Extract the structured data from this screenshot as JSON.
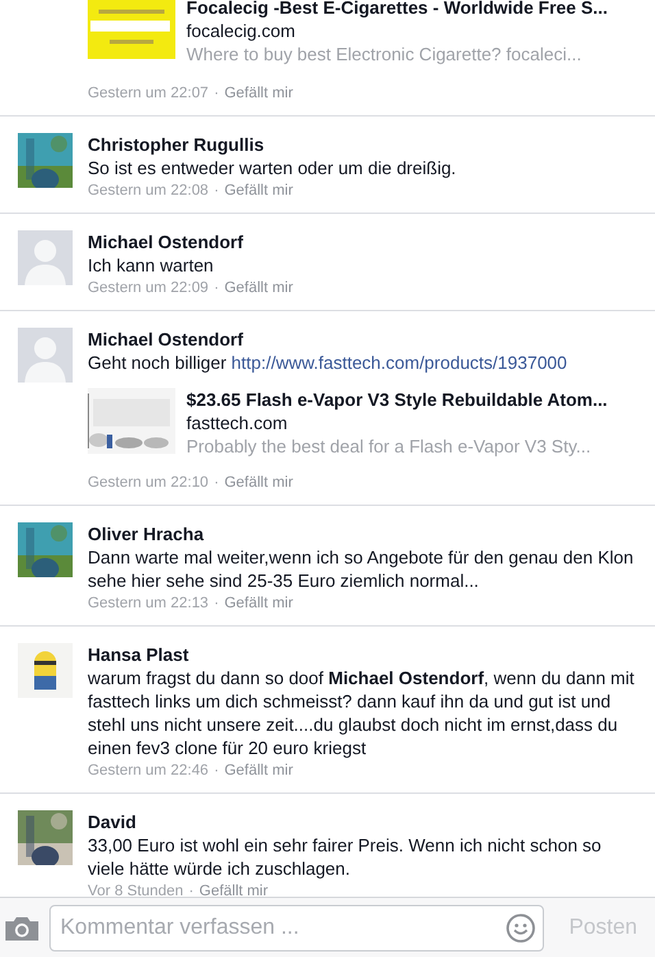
{
  "comments": [
    {
      "preview": {
        "title": "Focalecig -Best E-Cigarettes - Worldwide Free S...",
        "domain": "focalecig.com",
        "description": "Where to buy best Electronic Cigarette? focaleci..."
      },
      "time": "Gestern um 22:07",
      "dot": "·",
      "like": "Gefällt mir"
    },
    {
      "name": "Christopher Rugullis",
      "text": "So ist es entweder warten oder um die dreißig.",
      "time": "Gestern um 22:08",
      "dot": "·",
      "like": "Gefällt mir"
    },
    {
      "avatar": {
        "kind": "default"
      },
      "name": "Michael Ostendorf",
      "text": "Ich kann warten",
      "time": "Gestern um 22:09",
      "dot": "·",
      "like": "Gefällt mir"
    },
    {
      "avatar": {
        "kind": "default"
      },
      "name": "Michael Ostendorf",
      "text": "Geht noch billiger",
      "link": "http://www.fasttech.com/products/1937000",
      "preview": {
        "title": "$23.65 Flash e-Vapor V3 Style Rebuildable Atom...",
        "domain": "fasttech.com",
        "description": "Probably the best deal for a Flash e-Vapor V3 Sty..."
      },
      "time": "Gestern um 22:10",
      "dot": "·",
      "like": "Gefällt mir"
    },
    {
      "name": "Oliver Hracha",
      "text": "Dann warte mal weiter,wenn ich so Angebote für den genau den Klon sehe hier sehe sind 25-35 Euro ziemlich normal...",
      "time": "Gestern um 22:13",
      "dot": "·",
      "like": "Gefällt mir"
    },
    {
      "avatar": {
        "kind": "figure"
      },
      "name": "Hansa Plast",
      "text": "warum fragst du dann so doof **Michael Ostendorf**, wenn du dann mit fasttech links um dich schmeisst? dann kauf ihn da und gut ist und stehl uns nicht unsere zeit....du glaubst doch nicht im ernst,dass du einen fev3 clone für 20 euro kriegst",
      "time": "Gestern um 22:46",
      "dot": "·",
      "like": "Gefällt mir"
    },
    {
      "name": "David",
      "text": "33,00 Euro ist wohl ein sehr fairer Preis. Wenn ich nicht schon so viele hätte würde ich zuschlagen.",
      "time": "Vor 8 Stunden",
      "dot": "·",
      "like": "Gefällt mir"
    }
  ],
  "composer": {
    "placeholder": "Kommentar verfassen ...",
    "post_button": {
      "label": "Posten",
      "disabled": true
    }
  }
}
